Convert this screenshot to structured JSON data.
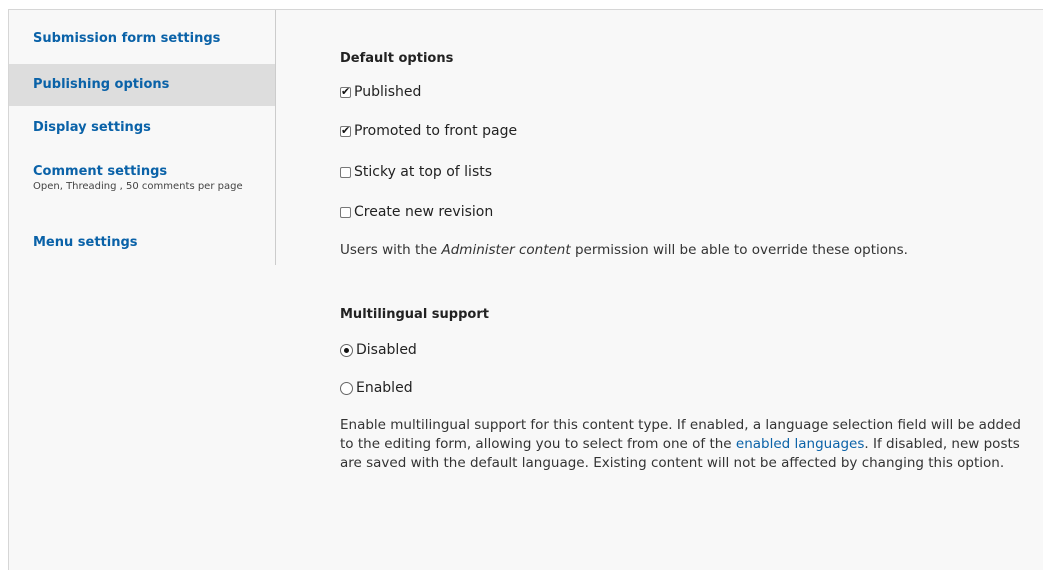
{
  "tabs": [
    {
      "label": "Submission form settings",
      "summary": ""
    },
    {
      "label": "Publishing options",
      "summary": "",
      "active": true
    },
    {
      "label": "Display settings",
      "summary": ""
    },
    {
      "label": "Comment settings",
      "summary": "Open, Threading , 50 comments per page"
    },
    {
      "label": "Menu settings",
      "summary": ""
    }
  ],
  "default_options": {
    "heading": "Default options",
    "options": [
      {
        "label": "Published",
        "checked": true
      },
      {
        "label": "Promoted to front page",
        "checked": true
      },
      {
        "label": "Sticky at top of lists",
        "checked": false
      },
      {
        "label": "Create new revision",
        "checked": false
      }
    ],
    "desc_before": "Users with the ",
    "desc_em": "Administer content",
    "desc_after": " permission will be able to override these options."
  },
  "multilingual": {
    "heading": "Multilingual support",
    "options": [
      {
        "label": "Disabled",
        "selected": true
      },
      {
        "label": "Enabled",
        "selected": false
      }
    ],
    "desc_before": "Enable multilingual support for this content type. If enabled, a language selection field will be added to the editing form, allowing you to select from one of the ",
    "desc_link": "enabled languages",
    "desc_after": ". If disabled, new posts are saved with the default language. Existing content will not be affected by changing this option."
  }
}
